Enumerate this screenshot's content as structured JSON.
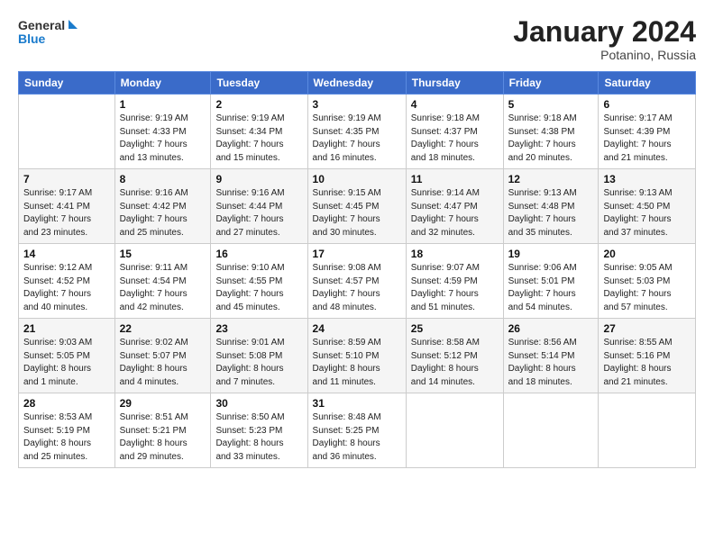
{
  "logo": {
    "line1": "General",
    "line2": "Blue"
  },
  "header": {
    "month": "January 2024",
    "location": "Potanino, Russia"
  },
  "weekdays": [
    "Sunday",
    "Monday",
    "Tuesday",
    "Wednesday",
    "Thursday",
    "Friday",
    "Saturday"
  ],
  "weeks": [
    [
      {
        "day": "",
        "info": ""
      },
      {
        "day": "1",
        "info": "Sunrise: 9:19 AM\nSunset: 4:33 PM\nDaylight: 7 hours\nand 13 minutes."
      },
      {
        "day": "2",
        "info": "Sunrise: 9:19 AM\nSunset: 4:34 PM\nDaylight: 7 hours\nand 15 minutes."
      },
      {
        "day": "3",
        "info": "Sunrise: 9:19 AM\nSunset: 4:35 PM\nDaylight: 7 hours\nand 16 minutes."
      },
      {
        "day": "4",
        "info": "Sunrise: 9:18 AM\nSunset: 4:37 PM\nDaylight: 7 hours\nand 18 minutes."
      },
      {
        "day": "5",
        "info": "Sunrise: 9:18 AM\nSunset: 4:38 PM\nDaylight: 7 hours\nand 20 minutes."
      },
      {
        "day": "6",
        "info": "Sunrise: 9:17 AM\nSunset: 4:39 PM\nDaylight: 7 hours\nand 21 minutes."
      }
    ],
    [
      {
        "day": "7",
        "info": "Sunrise: 9:17 AM\nSunset: 4:41 PM\nDaylight: 7 hours\nand 23 minutes."
      },
      {
        "day": "8",
        "info": "Sunrise: 9:16 AM\nSunset: 4:42 PM\nDaylight: 7 hours\nand 25 minutes."
      },
      {
        "day": "9",
        "info": "Sunrise: 9:16 AM\nSunset: 4:44 PM\nDaylight: 7 hours\nand 27 minutes."
      },
      {
        "day": "10",
        "info": "Sunrise: 9:15 AM\nSunset: 4:45 PM\nDaylight: 7 hours\nand 30 minutes."
      },
      {
        "day": "11",
        "info": "Sunrise: 9:14 AM\nSunset: 4:47 PM\nDaylight: 7 hours\nand 32 minutes."
      },
      {
        "day": "12",
        "info": "Sunrise: 9:13 AM\nSunset: 4:48 PM\nDaylight: 7 hours\nand 35 minutes."
      },
      {
        "day": "13",
        "info": "Sunrise: 9:13 AM\nSunset: 4:50 PM\nDaylight: 7 hours\nand 37 minutes."
      }
    ],
    [
      {
        "day": "14",
        "info": "Sunrise: 9:12 AM\nSunset: 4:52 PM\nDaylight: 7 hours\nand 40 minutes."
      },
      {
        "day": "15",
        "info": "Sunrise: 9:11 AM\nSunset: 4:54 PM\nDaylight: 7 hours\nand 42 minutes."
      },
      {
        "day": "16",
        "info": "Sunrise: 9:10 AM\nSunset: 4:55 PM\nDaylight: 7 hours\nand 45 minutes."
      },
      {
        "day": "17",
        "info": "Sunrise: 9:08 AM\nSunset: 4:57 PM\nDaylight: 7 hours\nand 48 minutes."
      },
      {
        "day": "18",
        "info": "Sunrise: 9:07 AM\nSunset: 4:59 PM\nDaylight: 7 hours\nand 51 minutes."
      },
      {
        "day": "19",
        "info": "Sunrise: 9:06 AM\nSunset: 5:01 PM\nDaylight: 7 hours\nand 54 minutes."
      },
      {
        "day": "20",
        "info": "Sunrise: 9:05 AM\nSunset: 5:03 PM\nDaylight: 7 hours\nand 57 minutes."
      }
    ],
    [
      {
        "day": "21",
        "info": "Sunrise: 9:03 AM\nSunset: 5:05 PM\nDaylight: 8 hours\nand 1 minute."
      },
      {
        "day": "22",
        "info": "Sunrise: 9:02 AM\nSunset: 5:07 PM\nDaylight: 8 hours\nand 4 minutes."
      },
      {
        "day": "23",
        "info": "Sunrise: 9:01 AM\nSunset: 5:08 PM\nDaylight: 8 hours\nand 7 minutes."
      },
      {
        "day": "24",
        "info": "Sunrise: 8:59 AM\nSunset: 5:10 PM\nDaylight: 8 hours\nand 11 minutes."
      },
      {
        "day": "25",
        "info": "Sunrise: 8:58 AM\nSunset: 5:12 PM\nDaylight: 8 hours\nand 14 minutes."
      },
      {
        "day": "26",
        "info": "Sunrise: 8:56 AM\nSunset: 5:14 PM\nDaylight: 8 hours\nand 18 minutes."
      },
      {
        "day": "27",
        "info": "Sunrise: 8:55 AM\nSunset: 5:16 PM\nDaylight: 8 hours\nand 21 minutes."
      }
    ],
    [
      {
        "day": "28",
        "info": "Sunrise: 8:53 AM\nSunset: 5:19 PM\nDaylight: 8 hours\nand 25 minutes."
      },
      {
        "day": "29",
        "info": "Sunrise: 8:51 AM\nSunset: 5:21 PM\nDaylight: 8 hours\nand 29 minutes."
      },
      {
        "day": "30",
        "info": "Sunrise: 8:50 AM\nSunset: 5:23 PM\nDaylight: 8 hours\nand 33 minutes."
      },
      {
        "day": "31",
        "info": "Sunrise: 8:48 AM\nSunset: 5:25 PM\nDaylight: 8 hours\nand 36 minutes."
      },
      {
        "day": "",
        "info": ""
      },
      {
        "day": "",
        "info": ""
      },
      {
        "day": "",
        "info": ""
      }
    ]
  ]
}
